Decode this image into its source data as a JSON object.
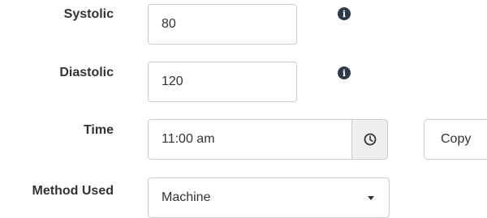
{
  "form": {
    "systolic": {
      "label": "Systolic",
      "value": "80",
      "info_icon": "info-circle-icon"
    },
    "diastolic": {
      "label": "Diastolic",
      "value": "120",
      "info_icon": "info-circle-icon"
    },
    "time": {
      "label": "Time",
      "value": "11:00 am",
      "clock_icon": "clock-icon",
      "copy_label": "Copy"
    },
    "method": {
      "label": "Method Used",
      "selected": "Machine",
      "caret_icon": "chevron-down-icon"
    }
  },
  "colors": {
    "label": "#333333",
    "border": "#cccccc",
    "addon_bg": "#eeeeee",
    "icon": "#2f3b46"
  }
}
